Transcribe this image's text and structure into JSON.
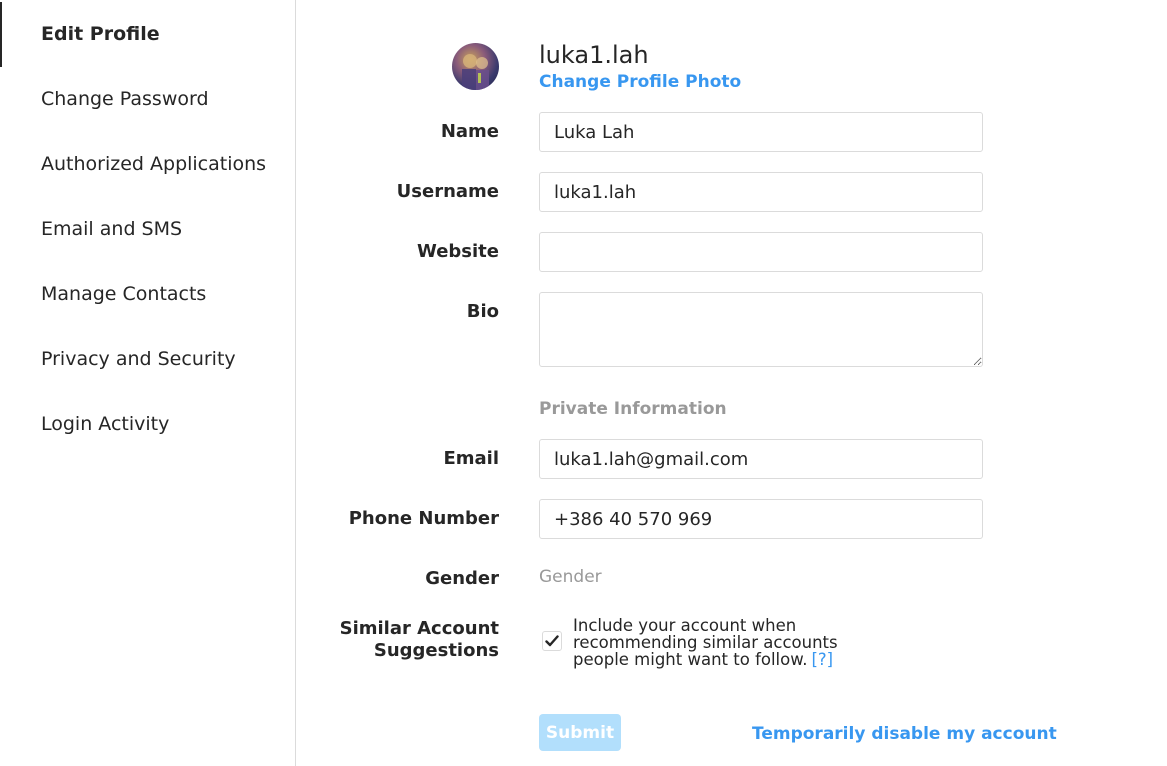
{
  "sidebar": {
    "items": [
      {
        "label": "Edit Profile",
        "active": true
      },
      {
        "label": "Change Password",
        "active": false
      },
      {
        "label": "Authorized Applications",
        "active": false
      },
      {
        "label": "Email and SMS",
        "active": false
      },
      {
        "label": "Manage Contacts",
        "active": false
      },
      {
        "label": "Privacy and Security",
        "active": false
      },
      {
        "label": "Login Activity",
        "active": false
      }
    ]
  },
  "profile": {
    "username": "luka1.lah",
    "change_photo_label": "Change Profile Photo"
  },
  "form": {
    "name": {
      "label": "Name",
      "value": "Luka Lah"
    },
    "username": {
      "label": "Username",
      "value": "luka1.lah"
    },
    "website": {
      "label": "Website",
      "value": ""
    },
    "bio": {
      "label": "Bio",
      "value": ""
    },
    "private_heading": "Private Information",
    "email": {
      "label": "Email",
      "value": "luka1.lah@gmail.com"
    },
    "phone": {
      "label": "Phone Number",
      "value": "+386 40 570 969"
    },
    "gender": {
      "label": "Gender",
      "value": "Gender"
    },
    "similar": {
      "label_line1": "Similar Account",
      "label_line2": "Suggestions",
      "checked": true,
      "description": "Include your account when recommending similar accounts people might want to follow.",
      "help": "[?]"
    },
    "submit_label": "Submit",
    "disable_label": "Temporarily disable my account"
  },
  "colors": {
    "accent": "#3897f0",
    "submit_disabled": "#b2dffc",
    "border": "#dbdbdb",
    "muted_text": "#999999",
    "text": "#262626"
  }
}
